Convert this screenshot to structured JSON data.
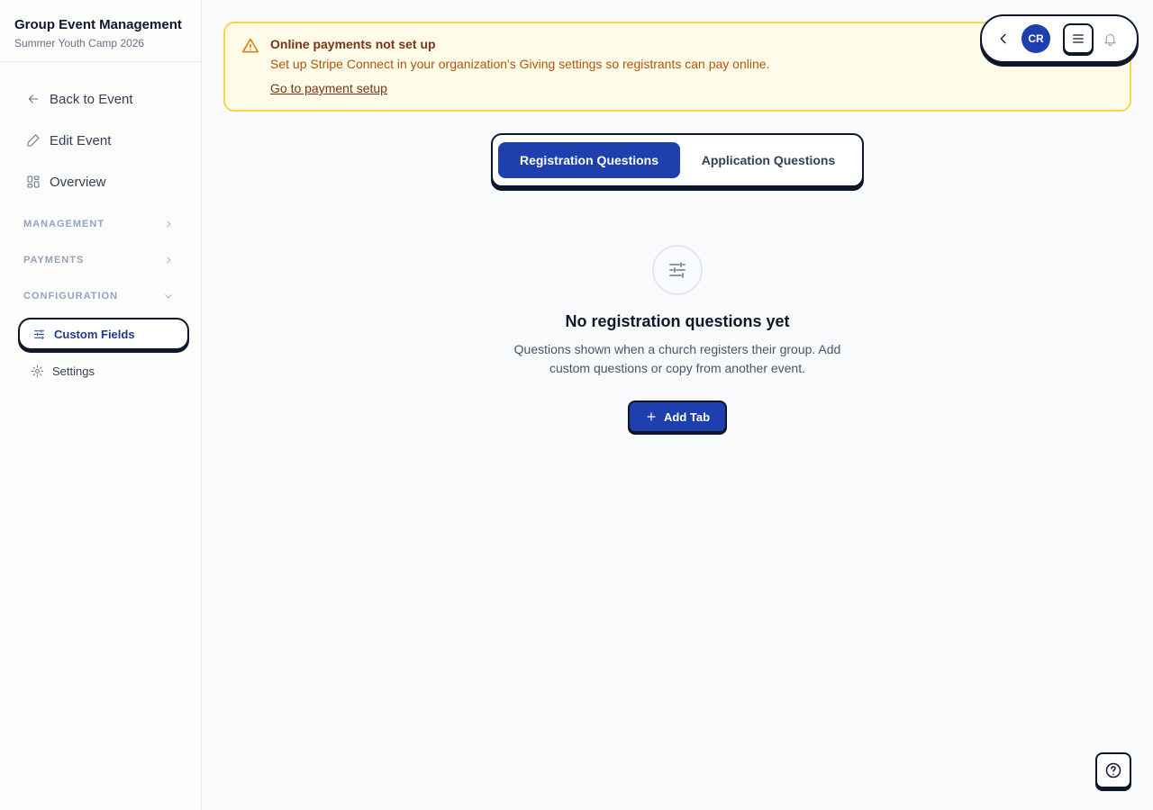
{
  "sidebar": {
    "title": "Group Event Management",
    "subtitle": "Summer Youth Camp 2026",
    "nav": [
      {
        "label": "Back to Event",
        "icon": "arrow-left-icon"
      },
      {
        "label": "Edit Event",
        "icon": "pencil-icon"
      },
      {
        "label": "Overview",
        "icon": "dashboard-icon"
      }
    ],
    "sections": {
      "management": "MANAGEMENT",
      "payments": "PAYMENTS",
      "configuration": "CONFIGURATION"
    },
    "config_items": [
      {
        "label": "Custom Fields",
        "icon": "sliders-icon",
        "active": true
      },
      {
        "label": "Settings",
        "icon": "gear-icon",
        "active": false
      }
    ]
  },
  "alert": {
    "title": "Online payments not set up",
    "text": "Set up Stripe Connect in your organization's Giving settings so registrants can pay online.",
    "link": "Go to payment setup",
    "icon": "warning-icon"
  },
  "toolbar": {
    "avatar_initials": "CR"
  },
  "tabs": [
    {
      "label": "Registration Questions",
      "active": true
    },
    {
      "label": "Application Questions",
      "active": false
    }
  ],
  "empty_state": {
    "icon": "sliders-icon",
    "title": "No registration questions yet",
    "description": "Questions shown when a church registers their group. Add custom questions or copy from another event.",
    "button": "Add Tab"
  },
  "colors": {
    "primary": "#1e40af",
    "outline": "#0f172a",
    "alert_bg": "#fefce8",
    "alert_border": "#fcd34d"
  }
}
